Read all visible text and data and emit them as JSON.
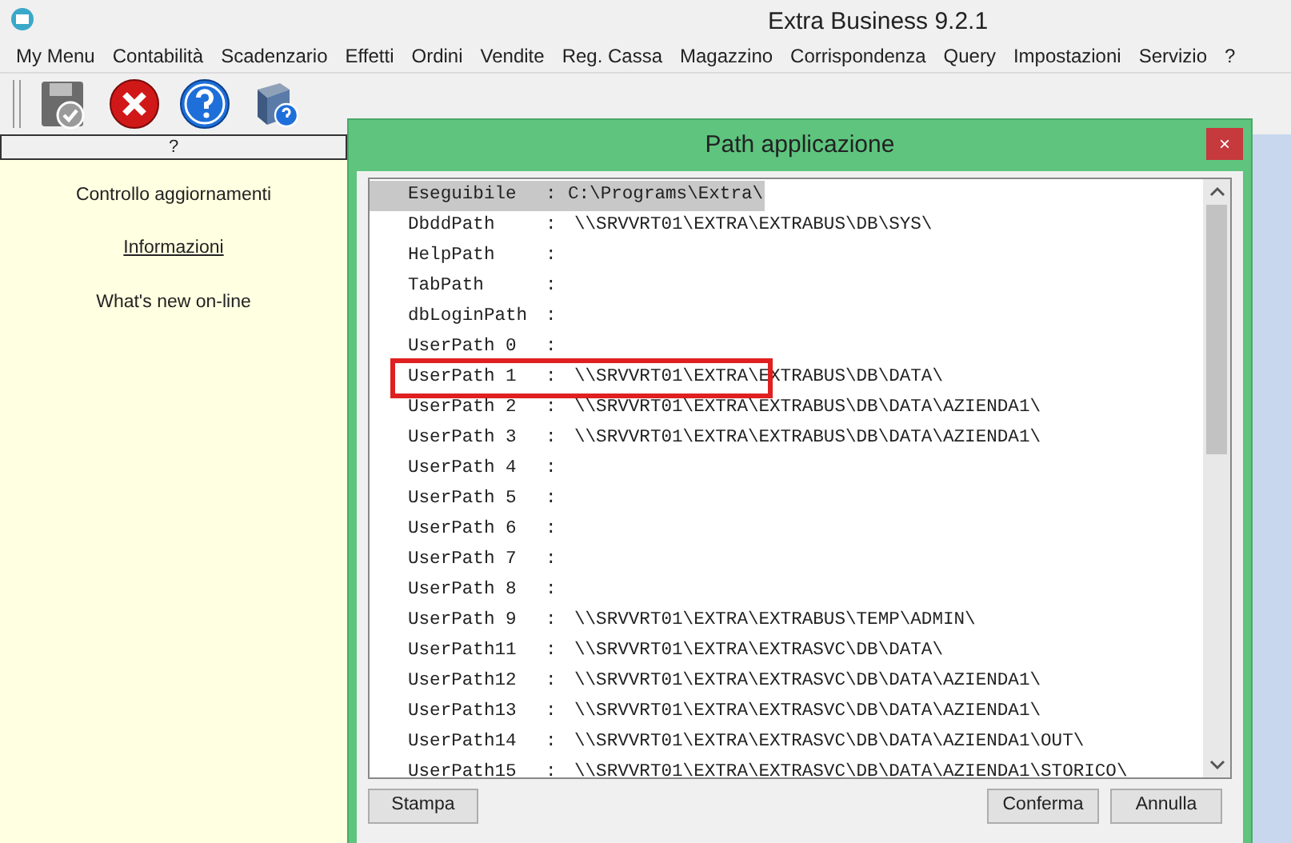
{
  "window": {
    "title": "Extra Business 9.2.1"
  },
  "menu": [
    "My Menu",
    "Contabilità",
    "Scadenzario",
    "Effetti",
    "Ordini",
    "Vendite",
    "Reg. Cassa",
    "Magazzino",
    "Corrispondenza",
    "Query",
    "Impostazioni",
    "Servizio",
    "?"
  ],
  "toolbar": [
    {
      "kind": "save"
    },
    {
      "kind": "close"
    },
    {
      "kind": "help"
    },
    {
      "kind": "manual"
    }
  ],
  "side_panel": {
    "header": "?",
    "items": [
      {
        "label": "Controllo aggiornamenti",
        "underlined": false
      },
      {
        "label": "Informazioni",
        "underlined": true
      },
      {
        "label": "What's new on-line",
        "underlined": false
      }
    ]
  },
  "dialog": {
    "title": "Path applicazione",
    "close": "×",
    "rows": [
      {
        "label": "Eseguibile",
        "sep": ":",
        "value": "C:\\Programs\\Extra\\",
        "selected": true,
        "outlined": false
      },
      {
        "label": "DbddPath",
        "sep": ":",
        "value": "\\\\SRVVRT01\\EXTRA\\EXTRABUS\\DB\\SYS\\",
        "selected": false,
        "outlined": false
      },
      {
        "label": "HelpPath",
        "sep": ":",
        "selected": false,
        "outlined": false
      },
      {
        "label": "TabPath",
        "sep": ":",
        "selected": false,
        "outlined": false
      },
      {
        "label": "dbLoginPath",
        "sep": ":",
        "selected": false,
        "outlined": false
      },
      {
        "label": "UserPath 0",
        "sep": ":",
        "selected": false,
        "outlined": false
      },
      {
        "label": "UserPath 1",
        "sep": ":",
        "value": "\\\\SRVVRT01\\EXTRA\\EXTRABUS\\DB\\DATA\\",
        "selected": false,
        "outlined": true
      },
      {
        "label": "UserPath 2",
        "sep": ":",
        "value": "\\\\SRVVRT01\\EXTRA\\EXTRABUS\\DB\\DATA\\AZIENDA1\\",
        "selected": false,
        "outlined": false
      },
      {
        "label": "UserPath 3",
        "sep": ":",
        "value": "\\\\SRVVRT01\\EXTRA\\EXTRABUS\\DB\\DATA\\AZIENDA1\\",
        "selected": false,
        "outlined": false
      },
      {
        "label": "UserPath 4",
        "sep": ":",
        "selected": false,
        "outlined": false
      },
      {
        "label": "UserPath 5",
        "sep": ":",
        "selected": false,
        "outlined": false
      },
      {
        "label": "UserPath 6",
        "sep": ":",
        "selected": false,
        "outlined": false
      },
      {
        "label": "UserPath 7",
        "sep": ":",
        "selected": false,
        "outlined": false
      },
      {
        "label": "UserPath 8",
        "sep": ":",
        "selected": false,
        "outlined": false
      },
      {
        "label": "UserPath 9",
        "sep": ":",
        "value": "\\\\SRVVRT01\\EXTRA\\EXTRABUS\\TEMP\\ADMIN\\",
        "selected": false,
        "outlined": false
      },
      {
        "label": "UserPath11",
        "sep": ":",
        "value": "\\\\SRVVRT01\\EXTRA\\EXTRASVC\\DB\\DATA\\",
        "selected": false,
        "outlined": false
      },
      {
        "label": "UserPath12",
        "sep": ":",
        "value": "\\\\SRVVRT01\\EXTRA\\EXTRASVC\\DB\\DATA\\AZIENDA1\\",
        "selected": false,
        "outlined": false
      },
      {
        "label": "UserPath13",
        "sep": ":",
        "value": "\\\\SRVVRT01\\EXTRA\\EXTRASVC\\DB\\DATA\\AZIENDA1\\",
        "selected": false,
        "outlined": false
      },
      {
        "label": "UserPath14",
        "sep": ":",
        "value": "\\\\SRVVRT01\\EXTRA\\EXTRASVC\\DB\\DATA\\AZIENDA1\\OUT\\",
        "selected": false,
        "outlined": false
      },
      {
        "label": "UserPath15",
        "sep": ":",
        "value": "\\\\SRVVRT01\\EXTRA\\EXTRASVC\\DB\\DATA\\AZIENDA1\\STORICO\\",
        "selected": false,
        "outlined": false
      }
    ],
    "buttons_left": [
      "Stampa"
    ],
    "buttons_right": [
      "Conferma",
      "Annulla"
    ]
  }
}
